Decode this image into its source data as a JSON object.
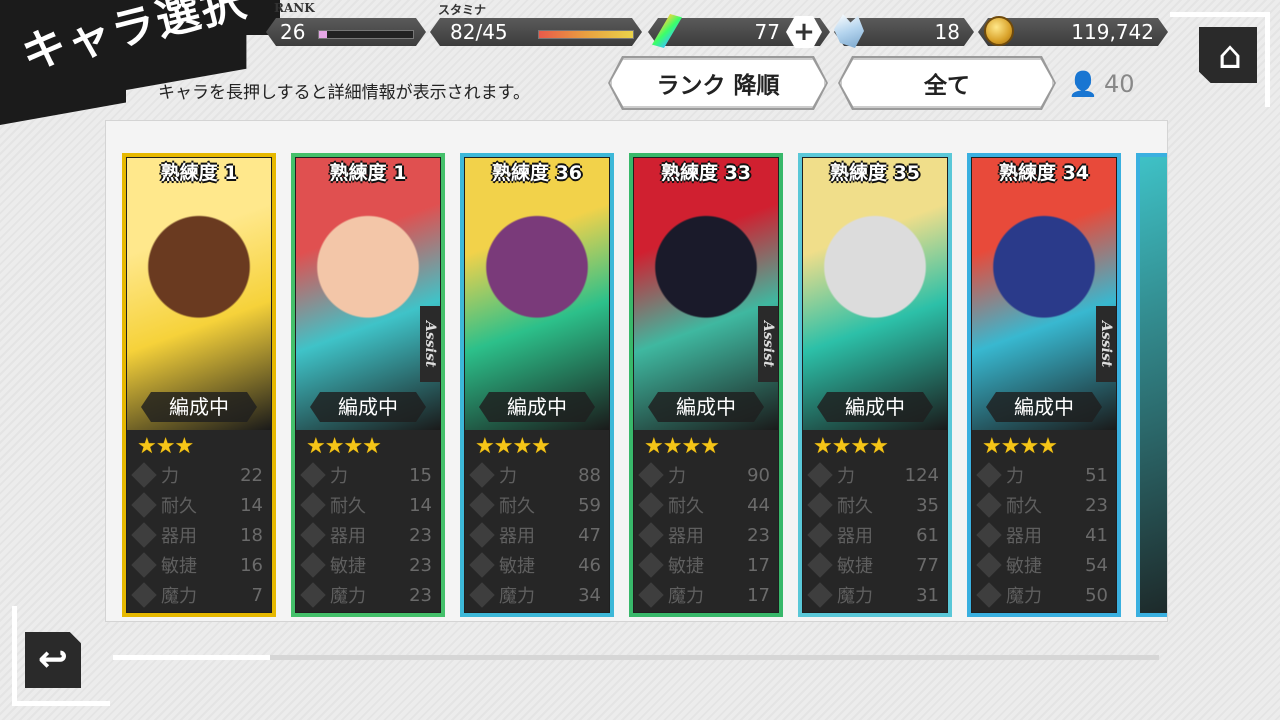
{
  "title": "キャラ選択",
  "status": {
    "rank_label": "RANK",
    "rank": "26",
    "rank_progress": 0.08,
    "stamina_label": "スタミナ",
    "stamina": "82/45",
    "stamina_progress": 1.0,
    "crystal": "77",
    "plus": "+",
    "gems": "18",
    "gold": "119,742"
  },
  "hint": "キャラを長押しすると詳細情報が表示されます。",
  "sort_label": "ランク 降順",
  "filter_label": "全て",
  "count": "40",
  "stat_names": [
    "力",
    "耐久",
    "器用",
    "敏捷",
    "魔力"
  ],
  "formation_label": "編成中",
  "assist_label": "Assist",
  "cards": [
    {
      "prof": "熟練度 1",
      "stars": "★★★",
      "stars_count": 3,
      "frame": "#e6b800",
      "art": [
        "#f6d23a",
        "#ffe88c",
        "#6a3a20"
      ],
      "assist": false,
      "stats": [
        "22",
        "14",
        "18",
        "16",
        "7"
      ]
    },
    {
      "prof": "熟練度 1",
      "stars": "★★★★",
      "stars_count": 4,
      "frame": "#44c06a",
      "art": [
        "#3fc3c8",
        "#e05050",
        "#f3c6a8"
      ],
      "assist": true,
      "stats": [
        "15",
        "14",
        "23",
        "23",
        "23"
      ]
    },
    {
      "prof": "熟練度 36",
      "stars": "★★★★",
      "stars_count": 4,
      "frame": "#3db8d8",
      "art": [
        "#2cc08a",
        "#f2d24a",
        "#7a3a7a"
      ],
      "assist": false,
      "stats": [
        "88",
        "59",
        "47",
        "46",
        "34"
      ]
    },
    {
      "prof": "熟練度 33",
      "stars": "★★★★",
      "stars_count": 4,
      "frame": "#38b86a",
      "art": [
        "#3fb8a0",
        "#d02030",
        "#1a1a2a"
      ],
      "assist": true,
      "stats": [
        "90",
        "44",
        "23",
        "17",
        "17"
      ]
    },
    {
      "prof": "熟練度 35",
      "stars": "★★★★",
      "stars_count": 4,
      "frame": "#5ac8d8",
      "art": [
        "#2cc0a8",
        "#f0de8a",
        "#dcdcdc"
      ],
      "assist": false,
      "stats": [
        "124",
        "35",
        "61",
        "77",
        "31"
      ]
    },
    {
      "prof": "熟練度 34",
      "stars": "★★★★",
      "stars_count": 4,
      "frame": "#3ab0e0",
      "art": [
        "#38b8d0",
        "#e84a3a",
        "#2a3a8a"
      ],
      "assist": true,
      "stats": [
        "51",
        "23",
        "41",
        "54",
        "50"
      ]
    }
  ],
  "scroll_progress": 0.15
}
